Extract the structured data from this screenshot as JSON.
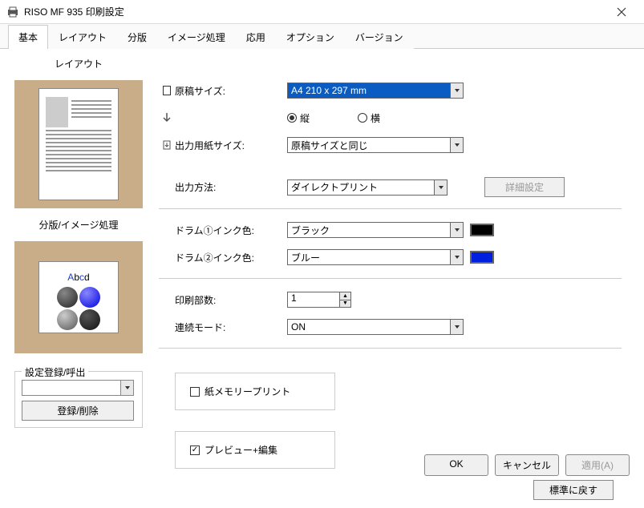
{
  "window": {
    "title": "RISO MF 935 印刷設定"
  },
  "tabs": [
    "基本",
    "レイアウト",
    "分版",
    "イメージ処理",
    "応用",
    "オプション",
    "バージョン"
  ],
  "preview": {
    "layout_label": "レイアウト",
    "image_label": "分版/イメージ処理",
    "abcd": "Abcd"
  },
  "settings_reg": {
    "group_label": "設定登録/呼出",
    "combo_value": "",
    "button": "登録/削除"
  },
  "form": {
    "original_size": {
      "label": "原稿サイズ:",
      "value": "A4 210 x 297 mm"
    },
    "orientation": {
      "portrait": "縦",
      "landscape": "横",
      "selected": "portrait"
    },
    "output_size": {
      "label": "出力用紙サイズ:",
      "value": "原稿サイズと同じ"
    },
    "output_method": {
      "label": "出力方法:",
      "value": "ダイレクトプリント",
      "detail_button": "詳細設定"
    },
    "drum1": {
      "label": "ドラム①インク色:",
      "value": "ブラック",
      "color": "#000000"
    },
    "drum2": {
      "label": "ドラム②インク色:",
      "value": "ブルー",
      "color": "#0020e0"
    },
    "copies": {
      "label": "印刷部数:",
      "value": "1"
    },
    "continuous": {
      "label": "連続モード:",
      "value": "ON"
    },
    "paper_memory": {
      "label": "紙メモリープリント",
      "checked": false
    },
    "preview_edit": {
      "label": "プレビュー+編集",
      "checked": true
    },
    "reset_button": "標準に戻す"
  },
  "dialog_buttons": {
    "ok": "OK",
    "cancel": "キャンセル",
    "apply": "適用(A)"
  }
}
